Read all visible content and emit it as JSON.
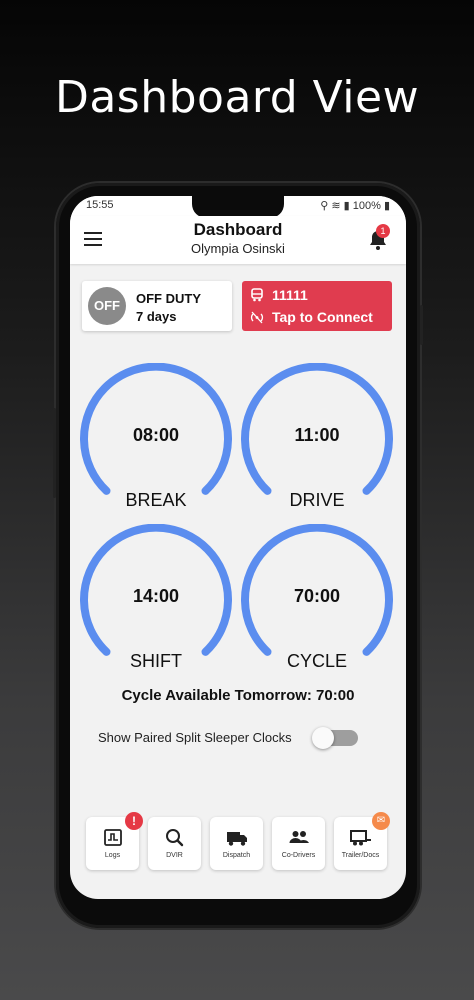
{
  "headline": "Dashboard View",
  "status_bar": {
    "time": "15:55",
    "battery": "100%"
  },
  "app_bar": {
    "title": "Dashboard",
    "subtitle": "Olympia Osinski",
    "notification_count": "1"
  },
  "duty": {
    "badge": "OFF",
    "status": "OFF DUTY",
    "duration": "7 days"
  },
  "vehicle": {
    "number": "11111",
    "connect_label": "Tap to Connect"
  },
  "clocks": [
    {
      "time": "08:00",
      "label": "BREAK"
    },
    {
      "time": "11:00",
      "label": "DRIVE"
    },
    {
      "time": "14:00",
      "label": "SHIFT"
    },
    {
      "time": "70:00",
      "label": "CYCLE"
    }
  ],
  "cycle_available": "Cycle Available Tomorrow: 70:00",
  "split_sleeper": {
    "label": "Show Paired Split Sleeper Clocks",
    "enabled": false
  },
  "bottom_nav": [
    {
      "label": "Logs",
      "icon": "logs-icon",
      "badge": "!"
    },
    {
      "label": "DVIR",
      "icon": "search-icon"
    },
    {
      "label": "Dispatch",
      "icon": "truck-icon"
    },
    {
      "label": "Co-Drivers",
      "icon": "people-icon"
    },
    {
      "label": "Trailer/Docs",
      "icon": "trailer-icon",
      "badge_icon": "mail-icon"
    }
  ],
  "colors": {
    "accent_blue": "#5b8def",
    "alert_red": "#e03c4f",
    "badge_orange": "#f58a4b",
    "off_gray": "#8a8a8a"
  }
}
